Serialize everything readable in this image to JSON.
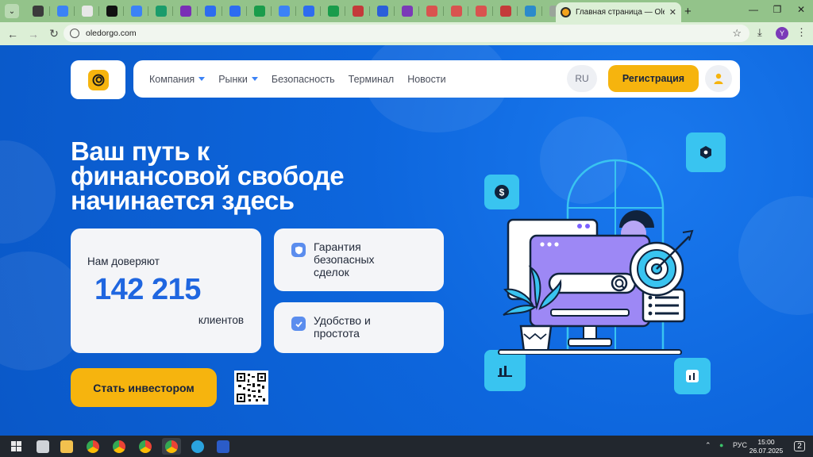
{
  "browser": {
    "tabs_menu_icon": "chevron-down-icon",
    "mini_tab_colors": [
      "#3b3b3b",
      "#3b82f6",
      "#e7e7e7",
      "#111111",
      "#3b82f6",
      "#1a9c6b",
      "#7a2fb6",
      "#2d6cf0",
      "#2d6cf0",
      "#1a9c4b",
      "#3b82f6",
      "#2d6cf0",
      "#1a9c4b",
      "#c43a3a",
      "#2b5fd9",
      "#7b3ab8",
      "#d9534f",
      "#d9534f",
      "#d9534f",
      "#c43a3a",
      "#2b8acb",
      "#9aa59a"
    ],
    "active_tab_title": "Главная страница — Oledorgo",
    "new_tab_icon": "+",
    "url": "oledorgo.com",
    "profile_initial": "Y"
  },
  "site": {
    "nav": {
      "items": [
        {
          "label": "Компания",
          "has_dropdown": true
        },
        {
          "label": "Рынки",
          "has_dropdown": true
        },
        {
          "label": "Безопасность",
          "has_dropdown": false
        },
        {
          "label": "Терминал",
          "has_dropdown": false
        },
        {
          "label": "Новости",
          "has_dropdown": false
        }
      ],
      "lang": "RU",
      "register_label": "Регистрация"
    },
    "hero": {
      "title_line1": "Ваш путь к",
      "title_line2": "финансовой свободе",
      "title_line3": "начинается здесь"
    },
    "trust": {
      "label": "Нам доверяют",
      "count": "142 215",
      "unit": "клиентов"
    },
    "features": [
      {
        "line1": "Гарантия",
        "line2": "безопасных",
        "line3": "сделок",
        "icon": "shield-icon"
      },
      {
        "line1": "Удобство и",
        "line2": "простота",
        "line3": "",
        "icon": "check-icon"
      }
    ],
    "cta_label": "Стать инвестором",
    "colors": {
      "accent": "#f6b40e",
      "brand_blue": "#1f66e0",
      "tile": "#39c4f0"
    }
  },
  "taskbar": {
    "lang": "РУС",
    "time": "15:00",
    "date": "26.07.2025",
    "notifications": "2"
  }
}
